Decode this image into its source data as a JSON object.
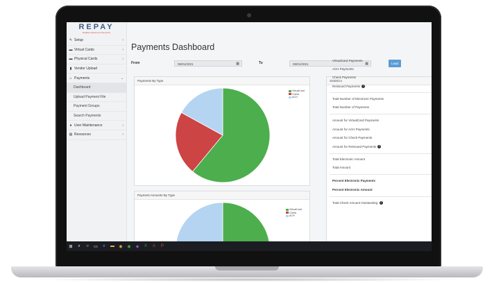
{
  "logo": {
    "brand": "REPAY",
    "tagline": "Realtime Electronic Payments"
  },
  "sidebar": {
    "items": [
      {
        "label": "Setup",
        "icon": "wrench-icon",
        "glyph": "✎",
        "chevron": "‹"
      },
      {
        "label": "Virtual Cards",
        "icon": "card-icon",
        "glyph": "▬",
        "chevron": "‹"
      },
      {
        "label": "Physical Cards",
        "icon": "card-icon",
        "glyph": "▬",
        "chevron": "‹"
      },
      {
        "label": "Vendor Upload",
        "icon": "file-icon",
        "glyph": "▮",
        "chevron": ""
      },
      {
        "label": "Payments",
        "icon": "bank-icon",
        "glyph": "⌂",
        "chevron": "⌄"
      }
    ],
    "payments_sub": [
      {
        "label": "Dashboard",
        "active": true
      },
      {
        "label": "Upload Payment File",
        "active": false
      },
      {
        "label": "Payment Groups",
        "active": false
      },
      {
        "label": "Search Payments",
        "active": false
      }
    ],
    "items_after": [
      {
        "label": "User Maintenance",
        "icon": "users-icon",
        "glyph": "●",
        "chevron": "‹"
      },
      {
        "label": "Resources",
        "icon": "book-icon",
        "glyph": "▤",
        "chevron": "‹"
      }
    ]
  },
  "main": {
    "title": "Payments Dashboard",
    "from_label": "From",
    "to_label": "To",
    "from_value": "05/01/2021",
    "to_value": "05/01/2021",
    "load_label": "Load",
    "calendar_glyph": "▦"
  },
  "charts": {
    "panel1_title": "Payments By Type",
    "panel2_title": "Payment Amounts By Type"
  },
  "chart_data": [
    {
      "type": "pie",
      "title": "Payments By Type",
      "categories": [
        "VirtualCard",
        "Check",
        "ACH"
      ],
      "values": [
        61,
        22,
        17
      ],
      "colors": [
        "#4cae4c",
        "#cc4444",
        "#b4d4f2"
      ],
      "legend_position": "top-right"
    },
    {
      "type": "pie",
      "title": "Payment Amounts By Type",
      "categories": [
        "VirtualCard",
        "Check",
        "ACH"
      ],
      "values": [
        50,
        0,
        50
      ],
      "colors": [
        "#4cae4c",
        "#cc4444",
        "#b4d4f2"
      ],
      "legend_position": "top-right"
    }
  ],
  "stats": {
    "title": "Statistics",
    "rows": [
      {
        "label": "VirtualCard Payments",
        "bold": false
      },
      {
        "label": "ACH Payments",
        "bold": false
      },
      {
        "label": "Check Payments",
        "bold": false
      },
      {
        "label": "Reissued Payments",
        "bold": false,
        "info": true
      },
      {
        "label": "Total Number of Electronic Payments",
        "bold": false
      },
      {
        "label": "Total Number of Payments",
        "bold": false
      },
      {
        "label": "Amount for VirtualCard Payments",
        "bold": false
      },
      {
        "label": "Amount for ACH Payments",
        "bold": false
      },
      {
        "label": "Amount for Check Payments",
        "bold": false
      },
      {
        "label": "Amount for Reissued Payments",
        "bold": false,
        "info": true
      },
      {
        "label": "Total Electronic Amount",
        "bold": false
      },
      {
        "label": "Total Amount",
        "bold": false
      },
      {
        "label": "Percent Electronic Payments",
        "bold": true
      },
      {
        "label": "Percent Electronic Amount",
        "bold": true
      },
      {
        "label": "Total Check Amount Outstanding",
        "bold": false,
        "info": true
      }
    ],
    "info_glyph": "?"
  },
  "taskbar": {
    "icons": [
      {
        "name": "windows-start-icon",
        "glyph": "⊞",
        "color": "#ffffff"
      },
      {
        "name": "search-icon",
        "glyph": "⌕",
        "color": "#ffffff"
      },
      {
        "name": "cortana-icon",
        "glyph": "○",
        "color": "#ffffff"
      },
      {
        "name": "task-view-icon",
        "glyph": "▭",
        "color": "#ffffff"
      },
      {
        "name": "edge-icon",
        "glyph": "e",
        "color": "#3a8ee6"
      },
      {
        "name": "file-explorer-icon",
        "glyph": "▬",
        "color": "#f2c14e"
      },
      {
        "name": "chrome-icon",
        "glyph": "◉",
        "color": "#e8b339"
      },
      {
        "name": "chrome-alt-icon",
        "glyph": "◉",
        "color": "#4caf50"
      },
      {
        "name": "app-icon",
        "glyph": "◆",
        "color": "#7e57c2"
      },
      {
        "name": "excel-icon",
        "glyph": "X",
        "color": "#2e9c53"
      },
      {
        "name": "acrobat-icon",
        "glyph": "A",
        "color": "#d9342b"
      },
      {
        "name": "powerpoint-icon",
        "glyph": "P",
        "color": "#d35230"
      }
    ]
  }
}
